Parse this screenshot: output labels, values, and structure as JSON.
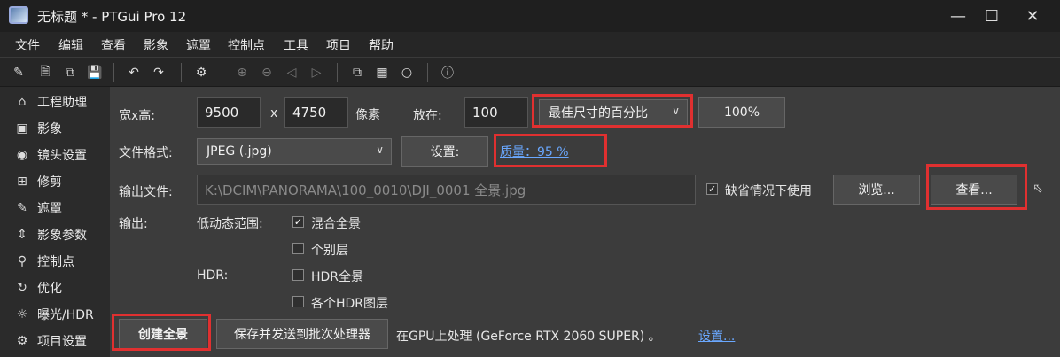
{
  "window": {
    "title": "无标题 * - PTGui Pro 12"
  },
  "menu": [
    "文件",
    "编辑",
    "查看",
    "影象",
    "遮罩",
    "控制点",
    "工具",
    "项目",
    "帮助"
  ],
  "sidebar": {
    "items": [
      {
        "label": "工程助理",
        "icon": "home-icon"
      },
      {
        "label": "影象",
        "icon": "image-icon"
      },
      {
        "label": "镜头设置",
        "icon": "camera-icon"
      },
      {
        "label": "修剪",
        "icon": "crop-icon"
      },
      {
        "label": "遮罩",
        "icon": "brush-icon"
      },
      {
        "label": "影象参数",
        "icon": "sliders-icon"
      },
      {
        "label": "控制点",
        "icon": "control-points-icon"
      },
      {
        "label": "优化",
        "icon": "optimize-icon"
      },
      {
        "label": "曝光/HDR",
        "icon": "sun-icon"
      },
      {
        "label": "项目设置",
        "icon": "gear-icon"
      }
    ]
  },
  "panel": {
    "size_label": "宽x高:",
    "width": "9500",
    "x_label": "x",
    "height": "4750",
    "pixels_label": "像素",
    "scale_label": "放在:",
    "scale_value": "100",
    "scale_mode": "最佳尺寸的百分比",
    "percent_button": "100%",
    "format_label": "文件格式:",
    "format_value": "JPEG (.jpg)",
    "format_settings_button": "设置:",
    "quality_link": "质量：95 %",
    "output_file_label": "输出文件:",
    "output_file_value": "K:\\DCIM\\PANORAMA\\100_0010\\DJI_0001 全景.jpg",
    "use_default_label": "缺省情况下使用",
    "use_default_checked": true,
    "browse_button": "浏览...",
    "view_button": "查看...",
    "output_label": "输出:",
    "ldr_label": "低动态范围:",
    "blended_label": "混合全景",
    "blended_checked": true,
    "layers_label": "个别层",
    "layers_checked": false,
    "hdr_label": "HDR:",
    "hdr_pano_label": "HDR全景",
    "hdr_pano_checked": false,
    "hdr_layers_label": "各个HDR图层",
    "hdr_layers_checked": false,
    "create_button": "创建全景",
    "batch_button": "保存并发送到批次处理器",
    "gpu_text": "在GPU上处理 (GeForce RTX 2060 SUPER) 。",
    "gpu_settings_link": "设置..."
  },
  "colors": {
    "highlight": "#e03030",
    "link": "#6aa8ff"
  }
}
